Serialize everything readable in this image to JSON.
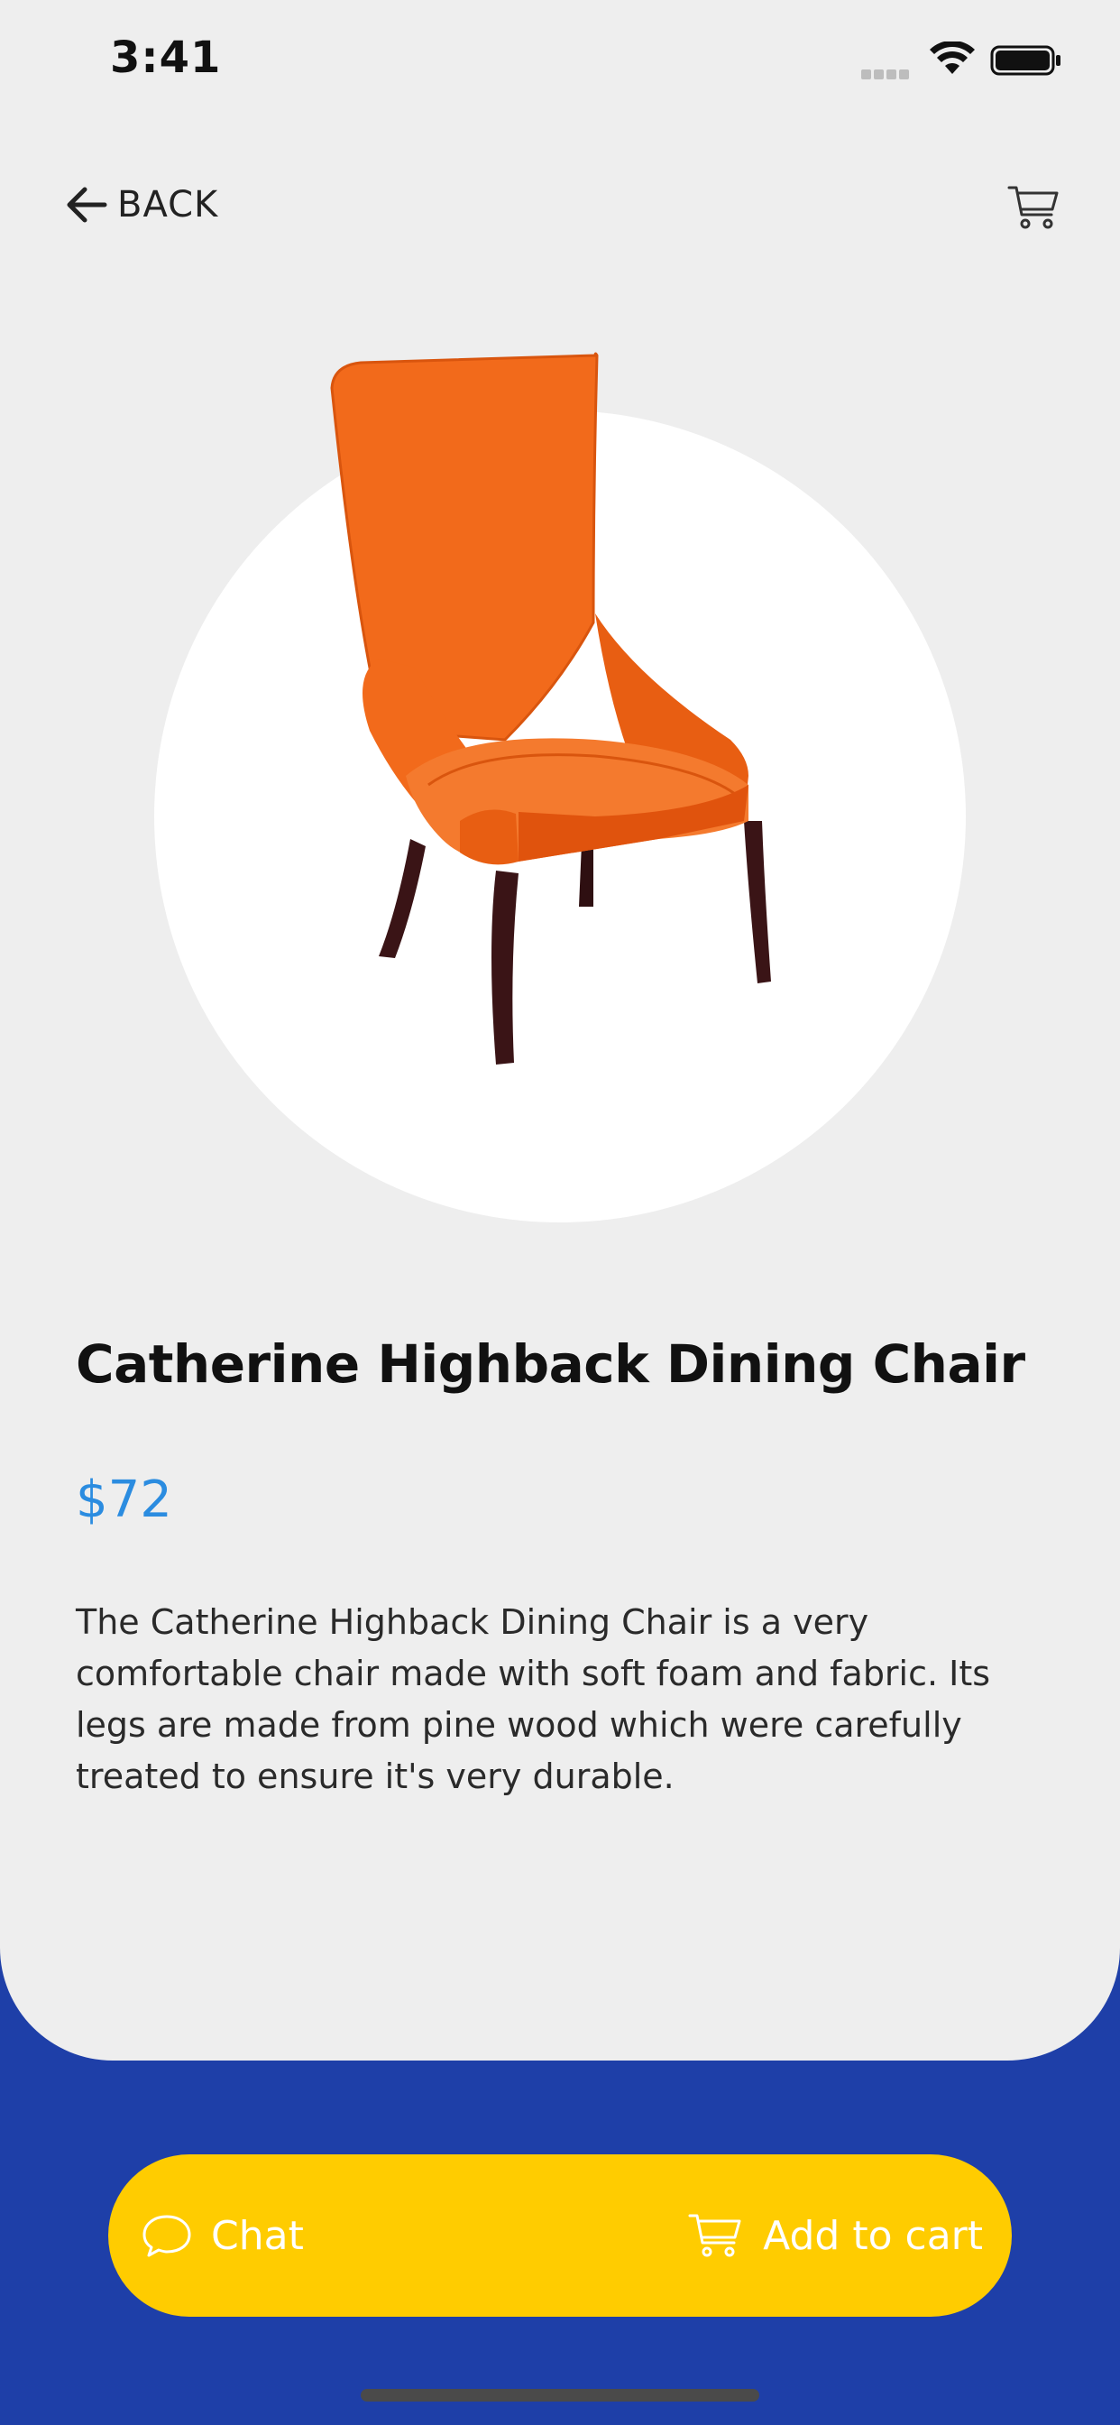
{
  "status_bar": {
    "time": "3:41"
  },
  "header": {
    "back_label": "BACK"
  },
  "product": {
    "title": "Catherine Highback Dining Chair",
    "price": "$72",
    "description": "The Catherine Highback Dining Chair is a very comfortable chair made with soft foam and fabric. Its legs are made from pine wood which were carefully treated to ensure it's very durable."
  },
  "actions": {
    "chat_label": "Chat",
    "add_to_cart_label": "Add to cart"
  },
  "icons": {
    "back": "arrow-left-icon",
    "cart": "cart-icon",
    "chat": "chat-bubble-icon",
    "wifi": "wifi-icon",
    "battery": "battery-icon"
  },
  "colors": {
    "background_top": "#EEEEEE",
    "background_bottom": "#1E3FA8",
    "price": "#2B8CE0",
    "action_bar": "#FFCC00",
    "chair_fabric": "#F26A1B",
    "chair_legs": "#3A1416"
  }
}
